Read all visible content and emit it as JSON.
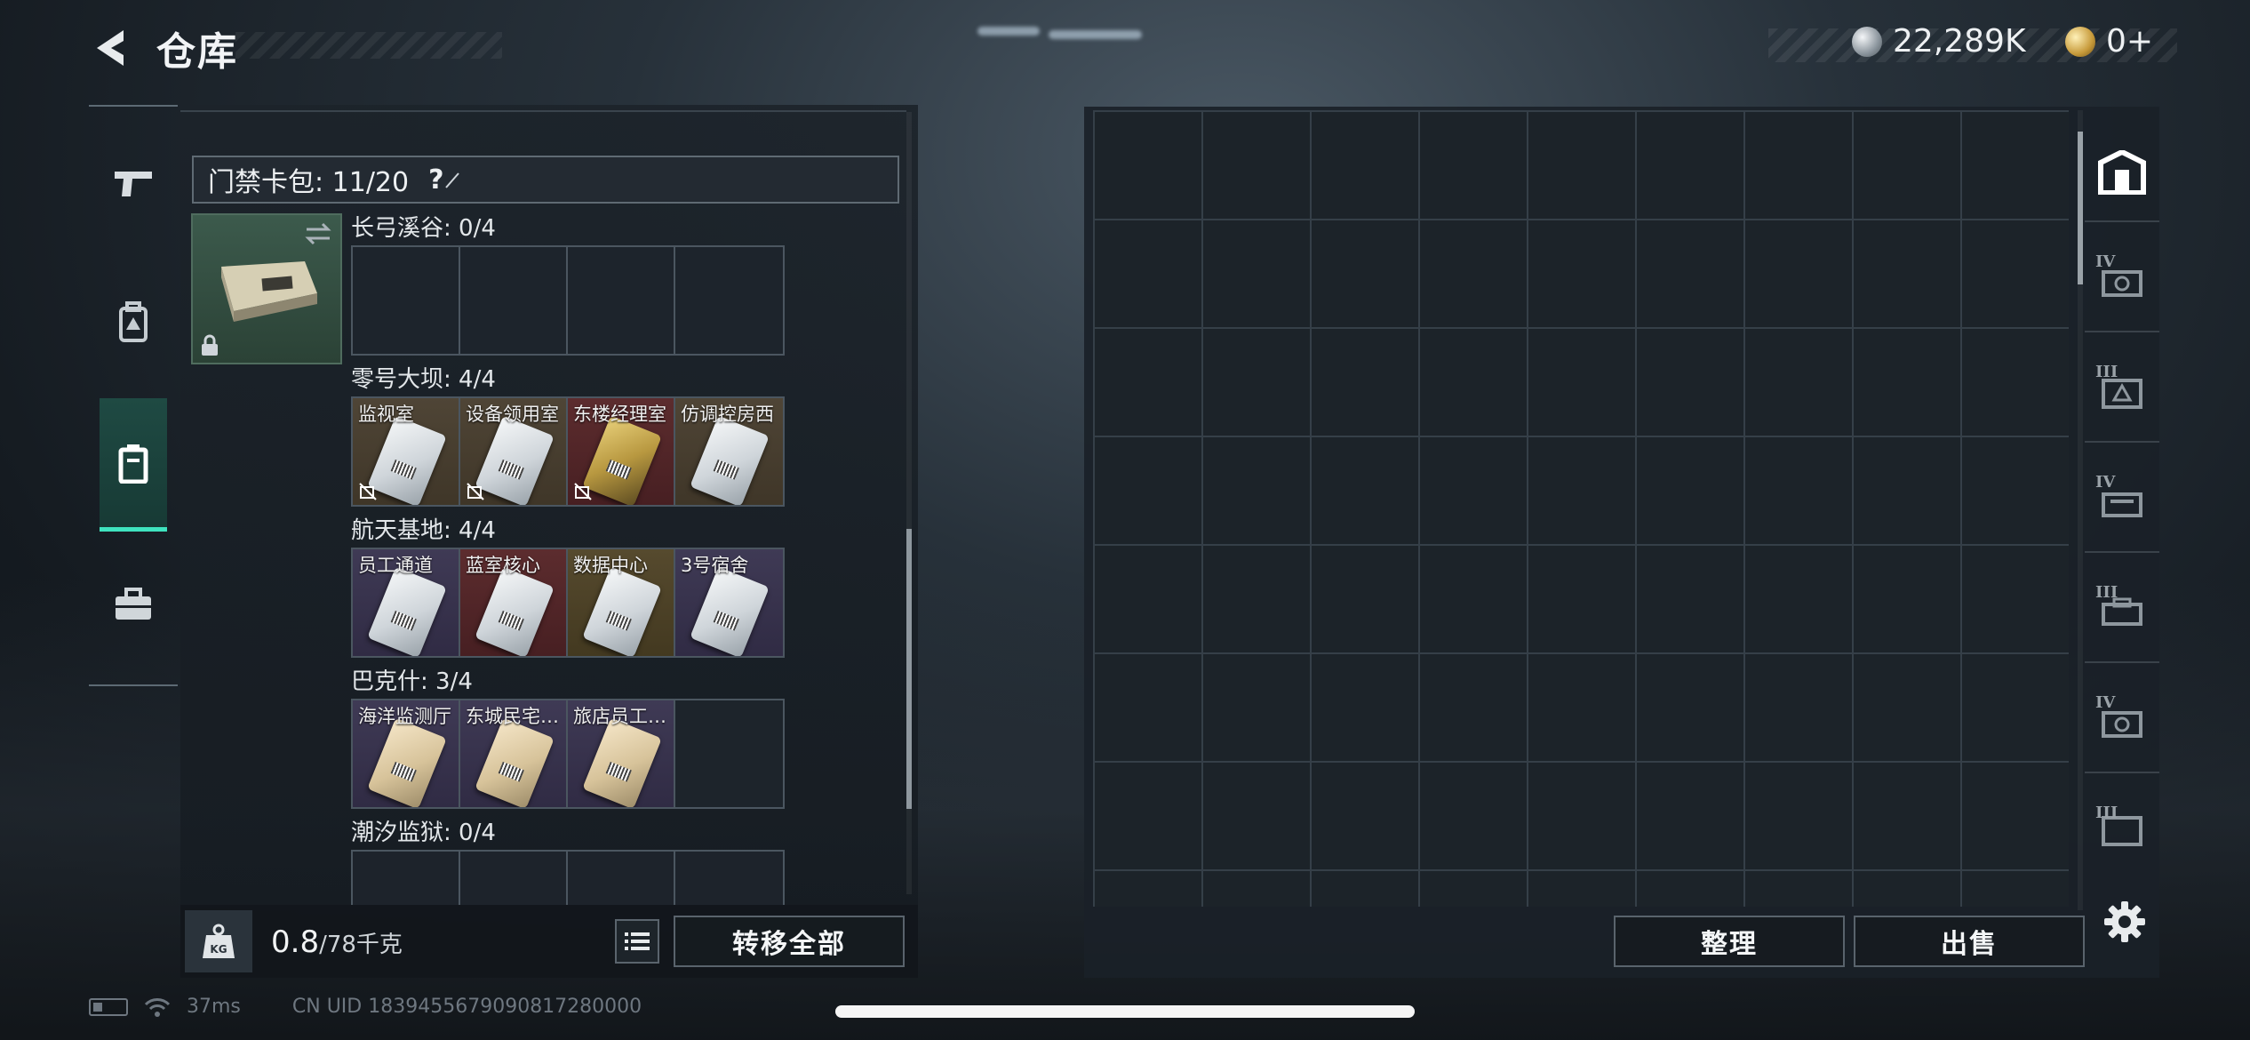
{
  "header": {
    "title": "仓库",
    "currency_silver": "22,289K",
    "currency_gold": "0+"
  },
  "keycase": {
    "label": "门禁卡包: 11/20",
    "help": "?"
  },
  "maps": [
    {
      "name": "长弓溪谷: 0/4",
      "slots": [
        "",
        "",
        "",
        ""
      ]
    },
    {
      "name": "零号大坝: 4/4",
      "slots": [
        "监视室",
        "设备领用室",
        "东楼经理室",
        "仿调控房西"
      ]
    },
    {
      "name": "航天基地: 4/4",
      "slots": [
        "员工通道",
        "蓝室核心",
        "数据中心",
        "3号宿舍"
      ]
    },
    {
      "name": "巴克什: 3/4",
      "slots": [
        "海洋监测厅",
        "东城民宅…",
        "旅店员工…",
        ""
      ]
    },
    {
      "name": "潮汐监狱: 0/4",
      "slots": [
        "",
        "",
        "",
        ""
      ]
    }
  ],
  "weight": {
    "current": "0.8",
    "max": "/78千克"
  },
  "buttons": {
    "transfer_all": "转移全部",
    "organize": "整理",
    "sell": "出售"
  },
  "rail_tiers": [
    "IV",
    "III",
    "IV",
    "III",
    "IV",
    "III"
  ],
  "status": {
    "ping": "37ms",
    "uid": "CN UID 1839455679090817280000"
  }
}
